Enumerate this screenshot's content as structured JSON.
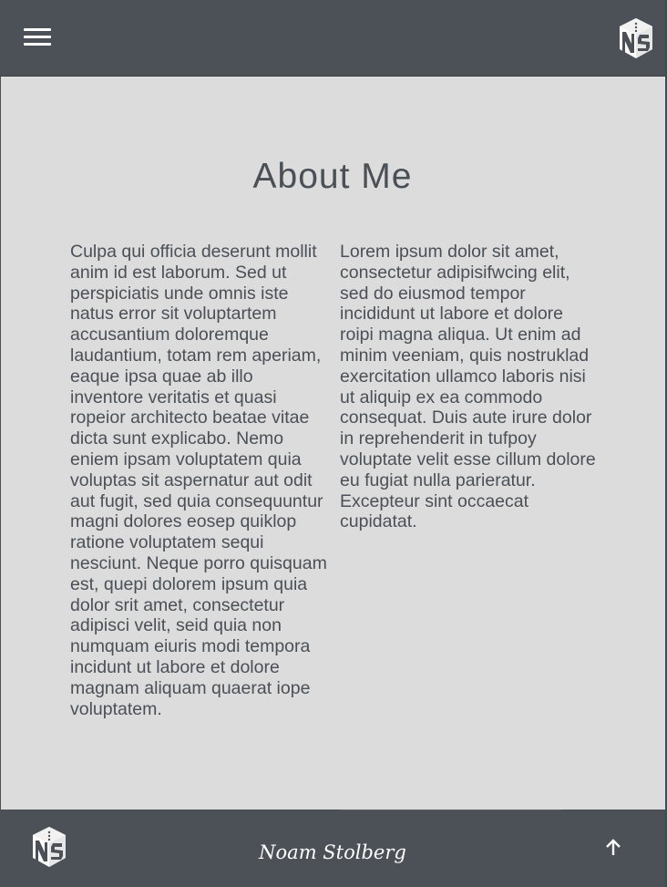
{
  "header": {
    "menu_icon": "hamburger-menu-icon",
    "logo_icon": "ns-cube-logo-icon"
  },
  "main": {
    "title": "About Me",
    "column_left": "Culpa qui officia deserunt mollit anim id est laborum. Sed ut perspiciatis unde omnis iste natus error sit voluptartem accusantium doloremque laudantium, totam rem aperiam, eaque ipsa quae ab illo inventore veritatis et quasi ropeior architecto beatae vitae dicta sunt explicabo. Nemo eniem ipsam voluptatem quia voluptas sit aspernatur aut odit aut fugit, sed quia consequuntur magni dolores eosep quiklop ratione voluptatem sequi nesciunt. Neque porro quisquam est, quepi dolorem ipsum quia dolor srit amet, consectetur adipisci velit, seid quia non numquam eiuris modi tempora incidunt ut labore et dolore magnam aliquam quaerat iope voluptatem.",
    "column_right": "Lorem ipsum dolor sit amet, consectetur adipisifwcing elit, sed do eiusmod tempor incididunt ut labore et dolore roipi magna aliqua. Ut enim ad minim veeniam, quis nostruklad exercitation ullamco laboris nisi ut aliquip ex ea commodo consequat. Duis aute irure dolor in reprehenderit in tufpoy voluptate velit esse cillum dolore eu fugiat nulla parieratur. Excepteur sint occaecat cupidatat."
  },
  "footer": {
    "signature": "Noam Stolberg",
    "logo_icon": "ns-cube-logo-icon",
    "up_icon": "arrow-up-icon"
  },
  "colors": {
    "bar": "#4b5157",
    "content_bg": "#dcdcdd",
    "text": "#4a5056",
    "accent_strip": "#1f5a56"
  }
}
